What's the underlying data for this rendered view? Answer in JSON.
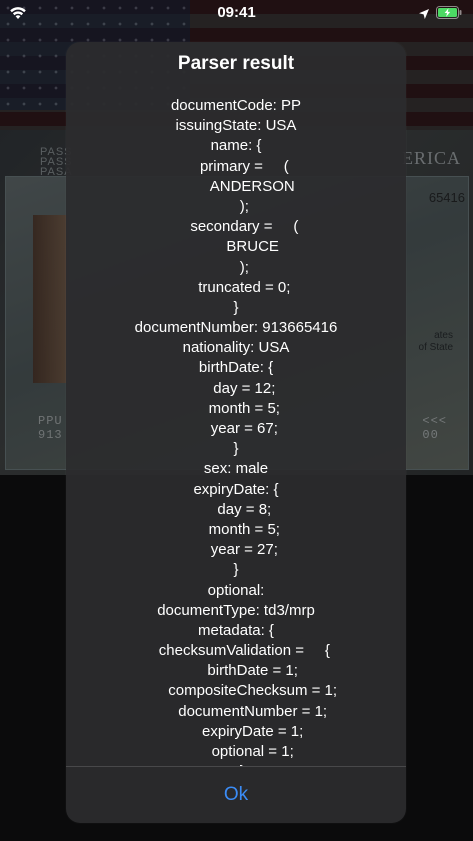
{
  "status_bar": {
    "time": "09:41",
    "icons": [
      "wifi-icon",
      "location-arrow-icon",
      "battery-charging-icon"
    ]
  },
  "background": {
    "header_left": [
      "PASS",
      "PASS",
      "PASA"
    ],
    "header_right": "ERICA",
    "number_right": "65416",
    "side_text": [
      "ates",
      "of State"
    ],
    "mrz_left": [
      "PPU",
      "913"
    ],
    "mrz_right": [
      "<<<",
      "00"
    ]
  },
  "alert": {
    "title": "Parser result",
    "lines": [
      "documentCode: PP",
      "issuingState: USA",
      "name: {",
      "    primary =     (",
      "        ANDERSON",
      "    );",
      "    secondary =     (",
      "        BRUCE",
      "    );",
      "    truncated = 0;",
      "}",
      "documentNumber: 913665416",
      "nationality: USA",
      "birthDate: {",
      "    day = 12;",
      "    month = 5;",
      "    year = 67;",
      "}",
      "sex: male",
      "expiryDate: {",
      "    day = 8;",
      "    month = 5;",
      "    year = 27;",
      "}",
      "optional:",
      "documentType: td3/mrp",
      "metadata: {",
      "    checksumValidation =     {",
      "        birthDate = 1;",
      "        compositeChecksum = 1;",
      "        documentNumber = 1;",
      "        expiryDate = 1;",
      "        optional = 1;",
      "    };"
    ],
    "ok_label": "Ok"
  }
}
